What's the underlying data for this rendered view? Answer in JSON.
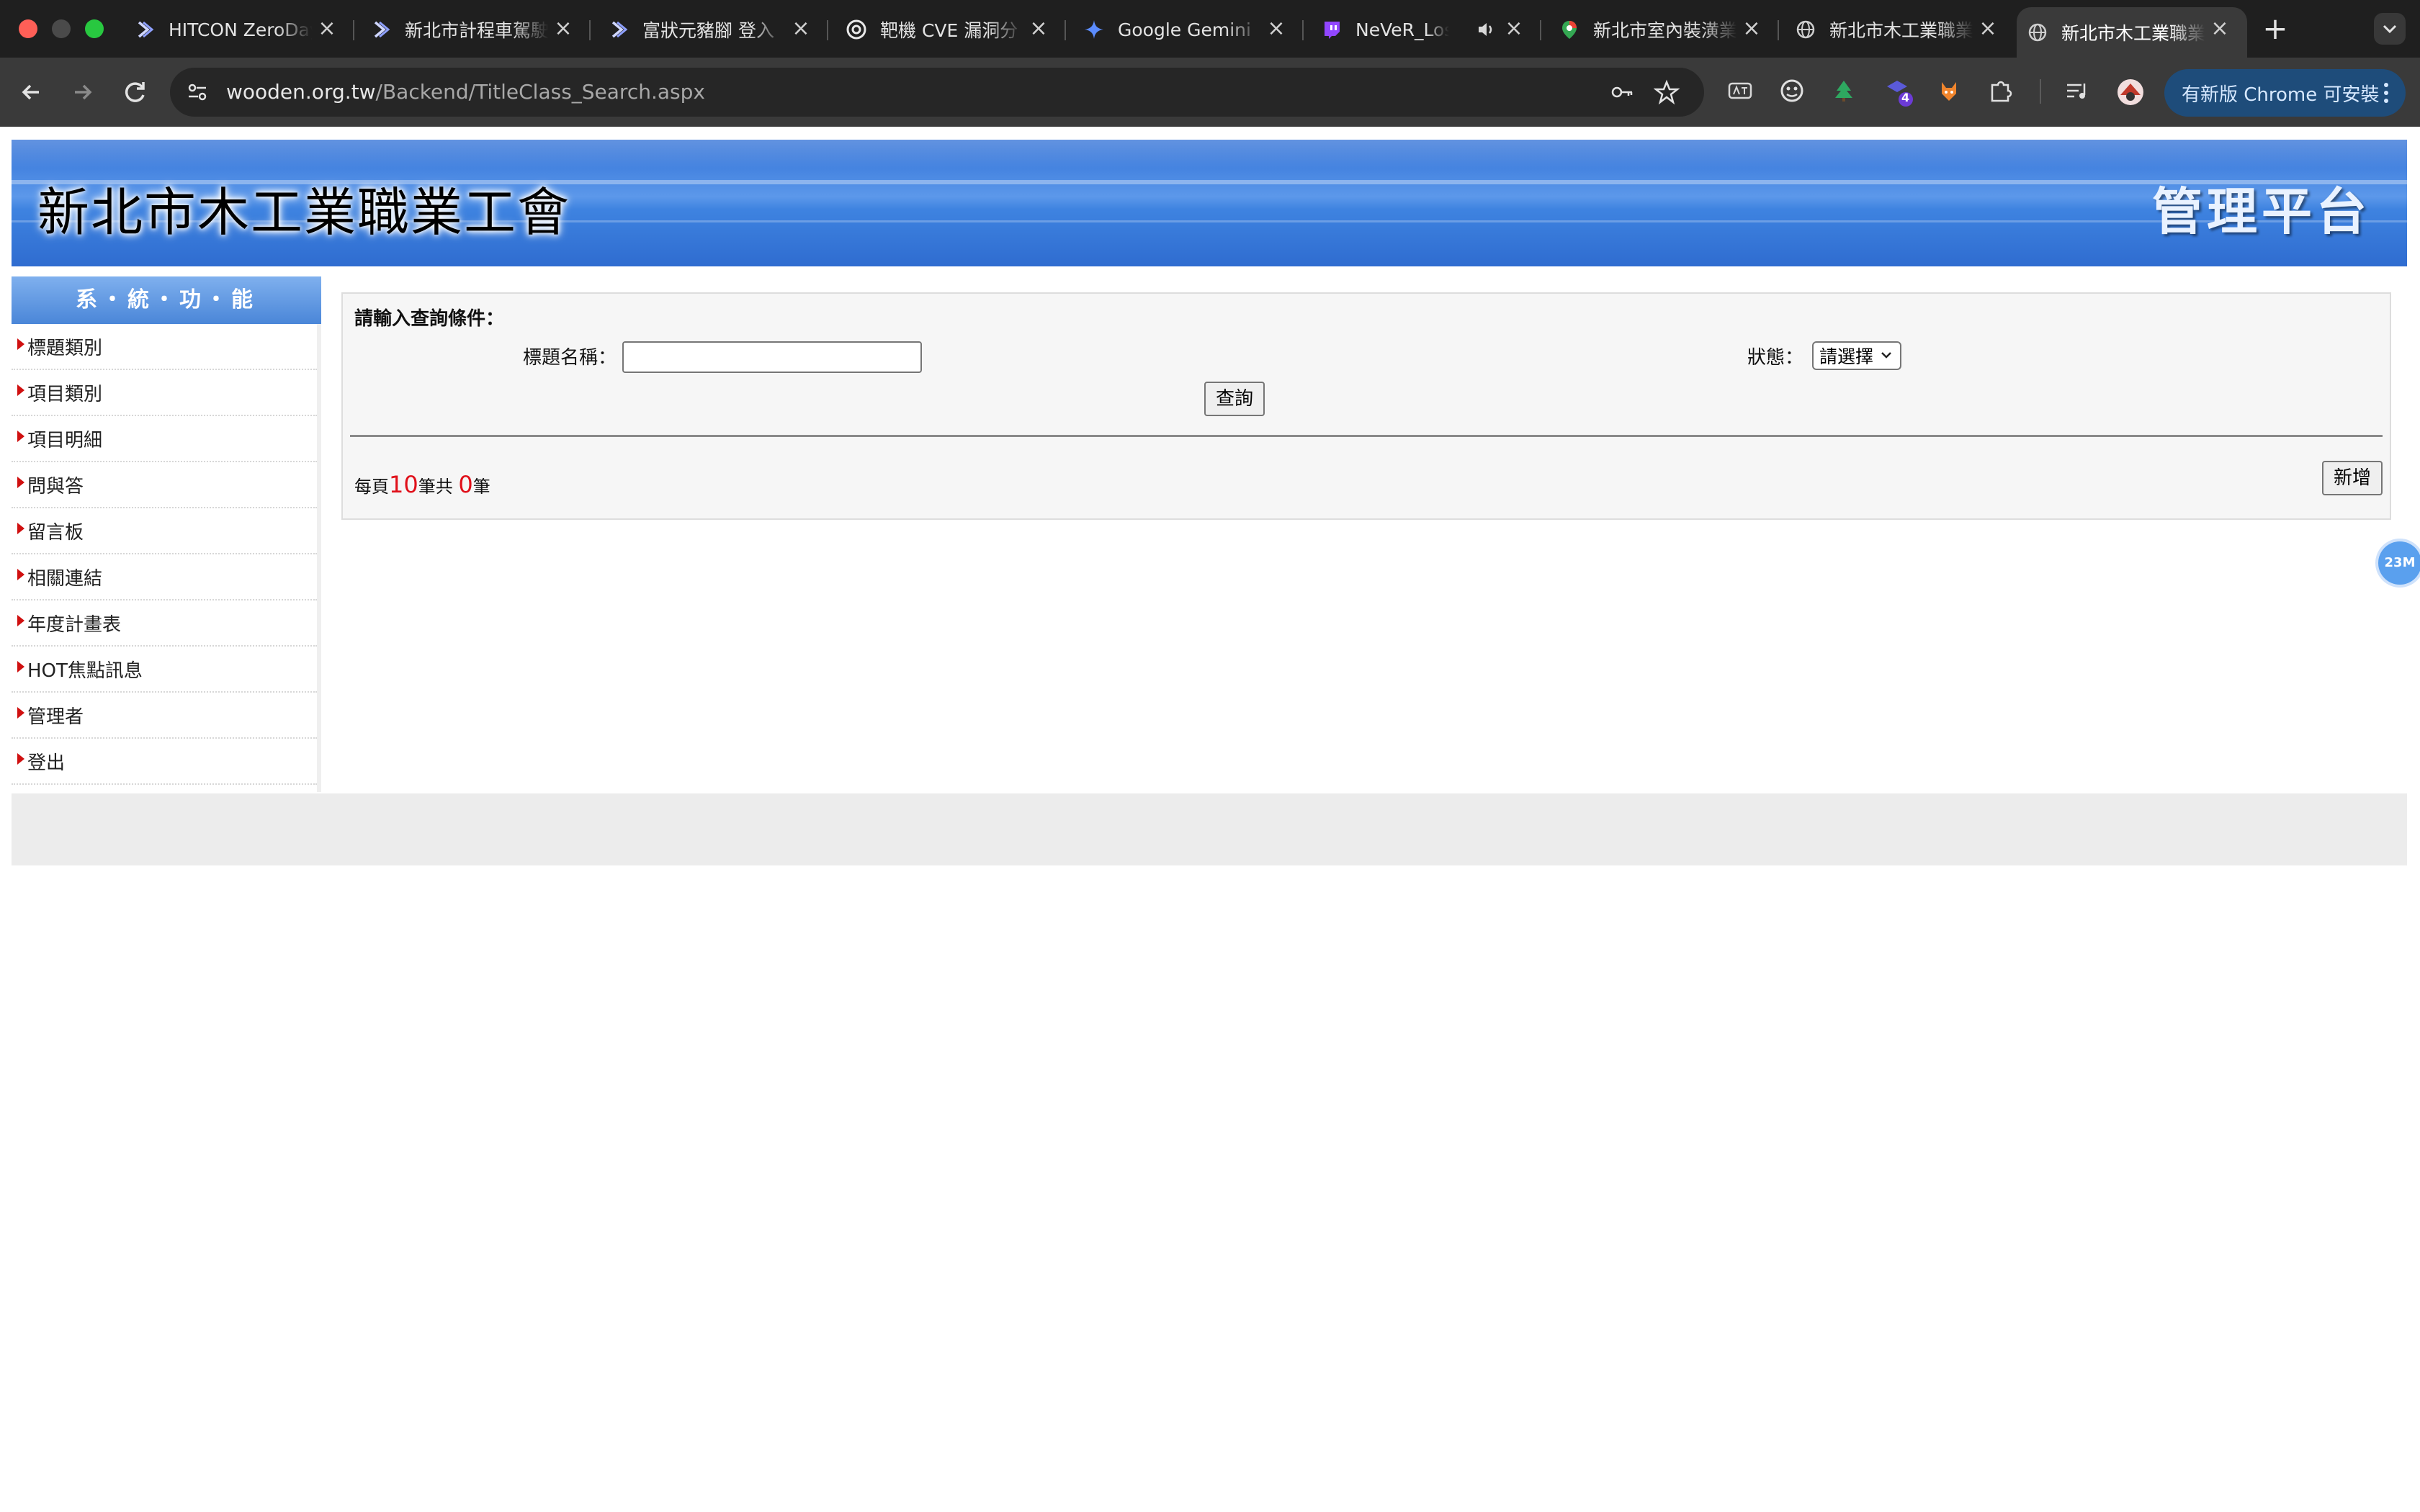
{
  "browser": {
    "tabs": [
      {
        "title": "HITCON ZeroDay",
        "icon": "hitcon-icon"
      },
      {
        "title": "新北市計程車駕駛",
        "icon": "hitcon-icon"
      },
      {
        "title": "富狀元豬腳 登入",
        "icon": "hitcon-icon"
      },
      {
        "title": "靶機 CVE 漏洞分",
        "icon": "openai-icon"
      },
      {
        "title": "Google Gemini",
        "icon": "gemini-icon"
      },
      {
        "title": "NeVeR_LosE",
        "icon": "twitch-icon"
      },
      {
        "title": "新北市室內裝潢業",
        "icon": "maps-pin-icon"
      },
      {
        "title": "新北市木工業職業",
        "icon": "globe-icon"
      },
      {
        "title": "新北市木工業職業",
        "icon": "globe-icon",
        "active": true
      }
    ],
    "url_host": "wooden.org.tw",
    "url_path": "/Backend/TitleClass_Search.aspx",
    "extension_badge": "4",
    "update_label": "有新版 Chrome 可安裝"
  },
  "header": {
    "site_title": "新北市木工業職業工會",
    "platform_label": "管理平台"
  },
  "sidebar": {
    "heading": "系・統・功・能",
    "items": [
      {
        "label": "標題類別"
      },
      {
        "label": "項目類別"
      },
      {
        "label": "項目明細"
      },
      {
        "label": "問與答"
      },
      {
        "label": "留言板"
      },
      {
        "label": "相關連結"
      },
      {
        "label": "年度計畫表"
      },
      {
        "label": "HOT焦點訊息"
      },
      {
        "label": "管理者"
      },
      {
        "label": "登出"
      }
    ]
  },
  "search": {
    "heading": "請輸入查詢條件：",
    "title_label": "標題名稱：",
    "title_value": "",
    "status_label": "狀態：",
    "status_selected": "請選擇",
    "button_label": "查詢"
  },
  "results": {
    "per_page_prefix": "每頁",
    "per_page": "10",
    "total_prefix": "筆共",
    "total": "0",
    "total_suffix": "筆",
    "add_label": "新增"
  },
  "float_badge": "23M",
  "colors": {
    "header_blue": "#3e83e0",
    "sidebar_head_blue": "#4a86d8",
    "pager_number_red": "#e0101a",
    "arrow_red": "#d01010"
  }
}
